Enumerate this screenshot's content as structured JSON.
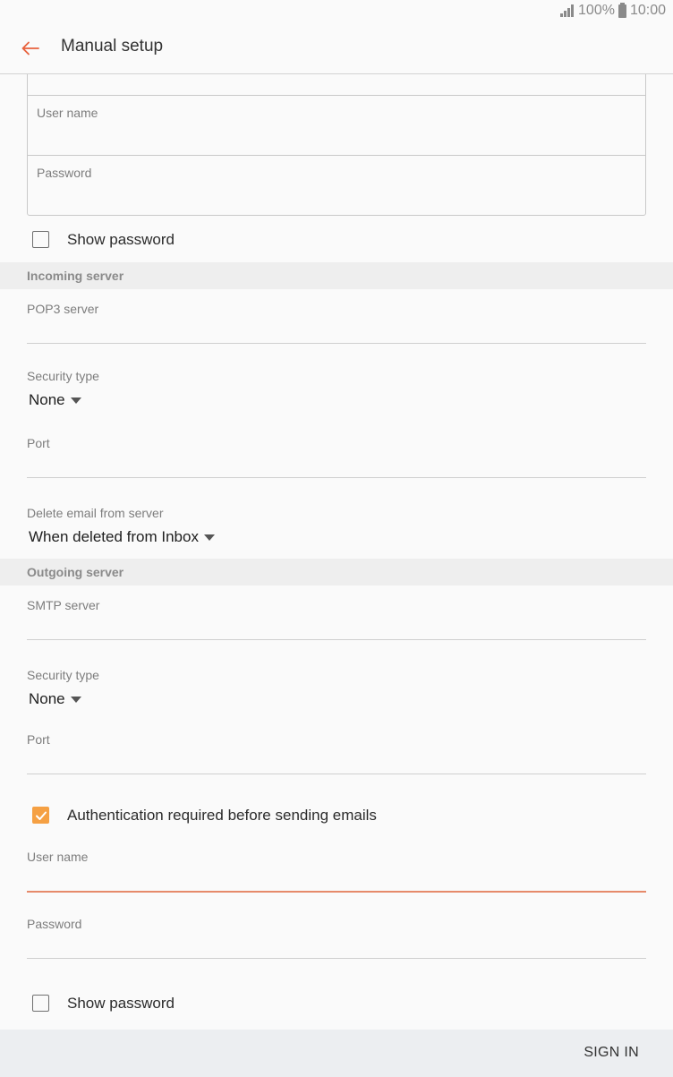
{
  "status_bar": {
    "battery": "100%",
    "time": "10:00"
  },
  "header": {
    "title": "Manual setup"
  },
  "account": {
    "username_label": "User name",
    "password_label": "Password",
    "show_password_label": "Show password",
    "show_password_checked": false
  },
  "incoming": {
    "section_title": "Incoming server",
    "server_label": "POP3 server",
    "security_label": "Security type",
    "security_value": "None",
    "port_label": "Port",
    "delete_label": "Delete email from server",
    "delete_value": "When deleted from Inbox"
  },
  "outgoing": {
    "section_title": "Outgoing server",
    "server_label": "SMTP server",
    "security_label": "Security type",
    "security_value": "None",
    "port_label": "Port",
    "auth_label": "Authentication required before sending emails",
    "auth_checked": true,
    "username_label": "User name",
    "password_label": "Password",
    "show_password_label": "Show password",
    "show_password_checked": false
  },
  "footer": {
    "sign_in_label": "SIGN IN"
  },
  "colors": {
    "accent": "#f5a043",
    "back_arrow": "#e8613c",
    "active_underline": "#e68a6a"
  },
  "icons": {
    "back": "arrow-left-icon",
    "signal": "signal-icon",
    "battery": "battery-icon",
    "dropdown": "caret-down-icon",
    "check": "check-icon"
  }
}
